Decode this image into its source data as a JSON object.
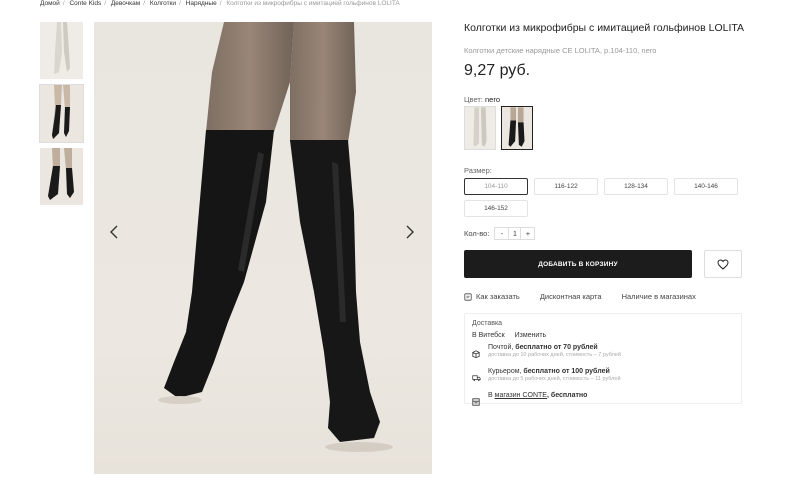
{
  "breadcrumb": {
    "items": [
      "Домой",
      "Conte Kids",
      "Девочкам",
      "Колготки",
      "Нарядные"
    ],
    "current": "Колготки из микрофибры с имитацией гольфинов LOLITA"
  },
  "product": {
    "title": "Колготки из микрофибры с имитацией гольфинов LOLITA",
    "subtitle": "Колготки детские нарядные CE LOLITA, р.104-110, nero",
    "price": "9,27 руб."
  },
  "color": {
    "label": "Цвет:",
    "selected": "nero",
    "swatches": [
      "light",
      "nero"
    ]
  },
  "size": {
    "label": "Размер:",
    "options": [
      "104-110",
      "116-122",
      "128-134",
      "140-146",
      "146-152"
    ],
    "selected": "104-110"
  },
  "quantity": {
    "label": "Кол-во:",
    "minus": "-",
    "value": "1",
    "plus": "+"
  },
  "actions": {
    "add_to_cart": "ДОБАВИТЬ В КОРЗИНУ"
  },
  "links": {
    "how_to_order": "Как заказать",
    "discount_card": "Дисконтная карта",
    "in_stores": "Наличие в магазинах"
  },
  "delivery": {
    "title": "Доставка",
    "city": "В Витебск",
    "change": "Изменить",
    "post_prefix": "Почтой, ",
    "post_bold": "бесплатно от 70 рублей",
    "post_note": "доставка до 10 рабочих дней, стоимость – 7 рублей",
    "courier_prefix": "Курьером, ",
    "courier_bold": "бесплатно от 100 рублей",
    "courier_note": "доставка до 5 рабочих дней, стоимость – 11 рублей",
    "store_prefix": "В ",
    "store_link": "магазин CONTE",
    "store_suffix": ", бесплатно"
  },
  "colors": {
    "button": "#1c1c1c",
    "background_photo": "#ebe7e0",
    "muted_text": "#999999"
  },
  "icons": [
    "chevron-left-icon",
    "chevron-right-icon",
    "heart-icon",
    "info-icon",
    "box-icon",
    "truck-icon",
    "store-icon"
  ]
}
